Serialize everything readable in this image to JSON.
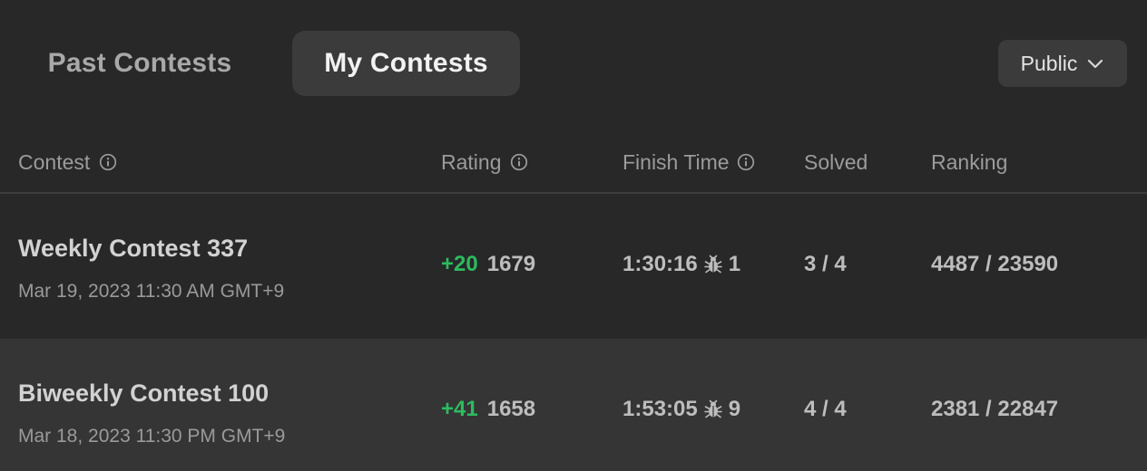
{
  "tabs": {
    "past": "Past Contests",
    "mine": "My Contests"
  },
  "filter": {
    "selected": "Public"
  },
  "columns": {
    "contest": "Contest",
    "rating": "Rating",
    "finish_time": "Finish Time",
    "solved": "Solved",
    "ranking": "Ranking"
  },
  "rows": [
    {
      "title": "Weekly Contest 337",
      "date": "Mar 19, 2023 11:30 AM GMT+9",
      "rating_delta": "+20",
      "rating": "1679",
      "finish_time": "1:30:16",
      "bugs": "1",
      "solved": "3 / 4",
      "ranking": "4487 / 23590"
    },
    {
      "title": "Biweekly Contest 100",
      "date": "Mar 18, 2023 11:30 PM GMT+9",
      "rating_delta": "+41",
      "rating": "1658",
      "finish_time": "1:53:05",
      "bugs": "9",
      "solved": "4 / 4",
      "ranking": "2381 / 22847"
    }
  ],
  "colors": {
    "background": "#282828",
    "row_alt": "#353535",
    "active_tab": "#3b3b3b",
    "rating_delta": "#2cbb5d"
  },
  "icons": {
    "column_info": "info-icon",
    "wrong_submissions": "bug-icon",
    "dropdown": "chevron-down-icon"
  }
}
